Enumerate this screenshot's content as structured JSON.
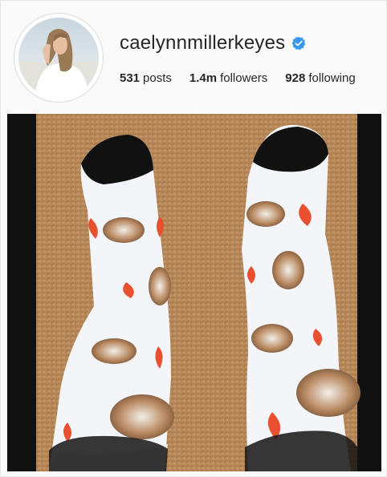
{
  "profile": {
    "username": "caelynnmillerkeyes",
    "verified": true,
    "posts_count": "531",
    "posts_label": "posts",
    "followers_count": "1.4m",
    "followers_label": "followers",
    "following_count": "928",
    "following_label": "following"
  },
  "icons": {
    "verified": "verified-badge-icon"
  },
  "colors": {
    "verified_blue": "#3897f0",
    "text": "#262626",
    "carpet": "#b8895a",
    "sock": "#f4f6f8",
    "sock_toe": "#111111",
    "heart": "#e8502f"
  }
}
